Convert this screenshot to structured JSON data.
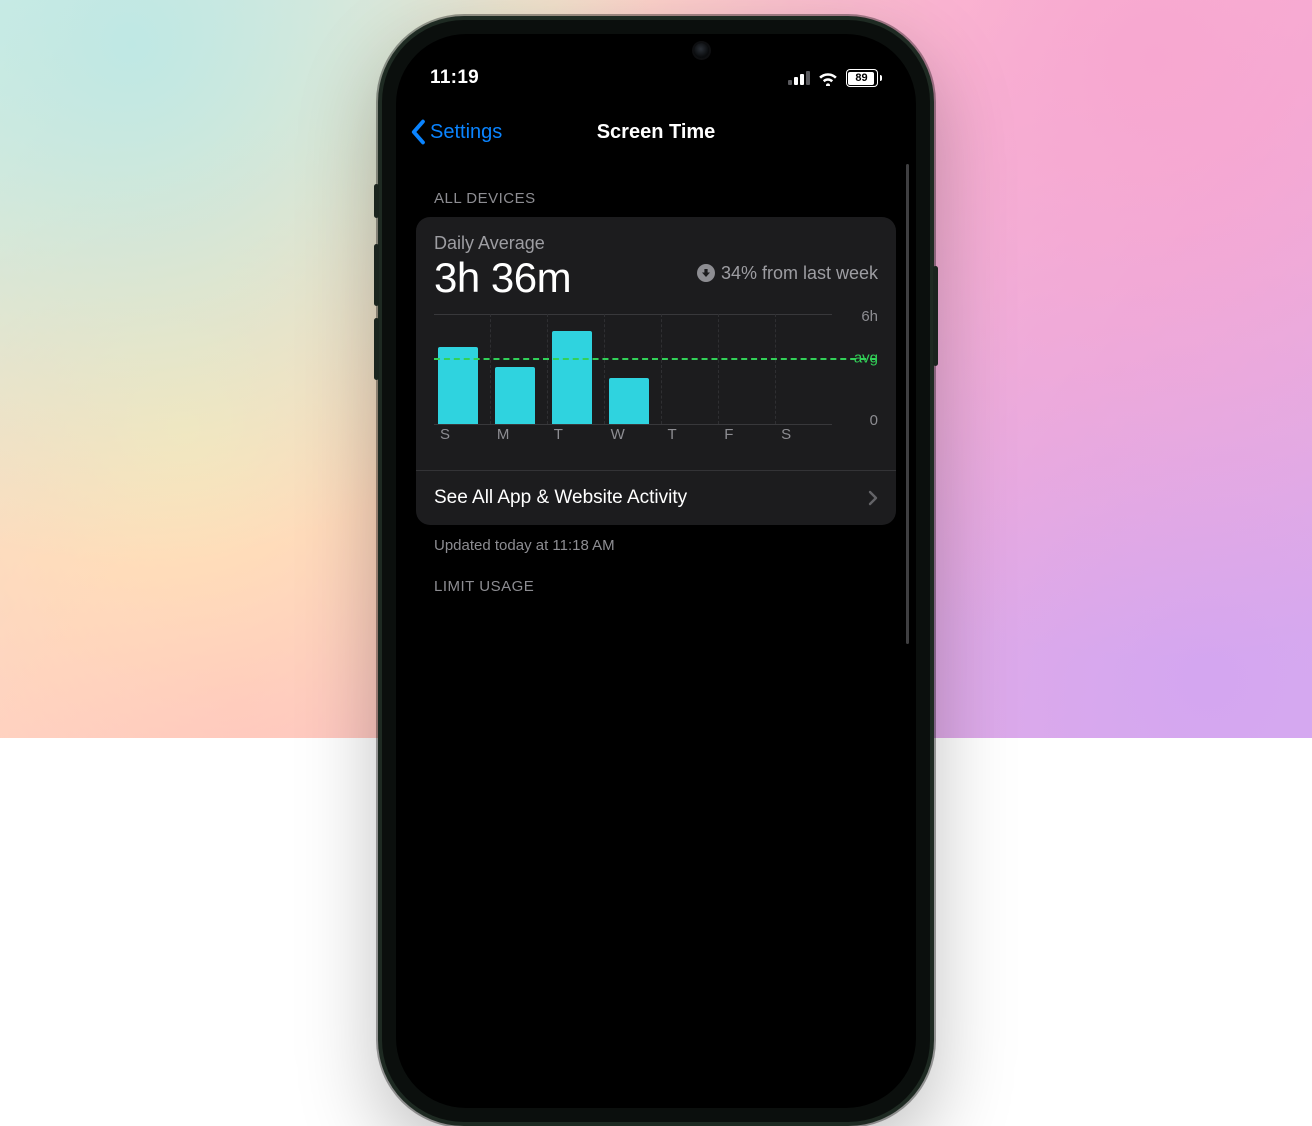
{
  "status": {
    "time": "11:19",
    "battery": "89"
  },
  "nav": {
    "back_label": "Settings",
    "title": "Screen Time"
  },
  "section_all_devices": "ALL DEVICES",
  "card": {
    "daily_average_label": "Daily Average",
    "daily_average_value": "3h 36m",
    "trend_text": "34% from last week",
    "see_all_label": "See All App & Website Activity"
  },
  "updated_text": "Updated today at 11:18 AM",
  "section_limit": "LIMIT USAGE",
  "chart_data": {
    "type": "bar",
    "title": "Daily Average",
    "categories": [
      "S",
      "M",
      "T",
      "W",
      "T",
      "F",
      "S"
    ],
    "values": [
      4.2,
      3.1,
      5.1,
      2.5,
      0,
      0,
      0
    ],
    "average": 3.6,
    "ylim": [
      0,
      6
    ],
    "ylabel_top": "6h",
    "ylabel_bottom": "0",
    "avg_label": "avg"
  }
}
